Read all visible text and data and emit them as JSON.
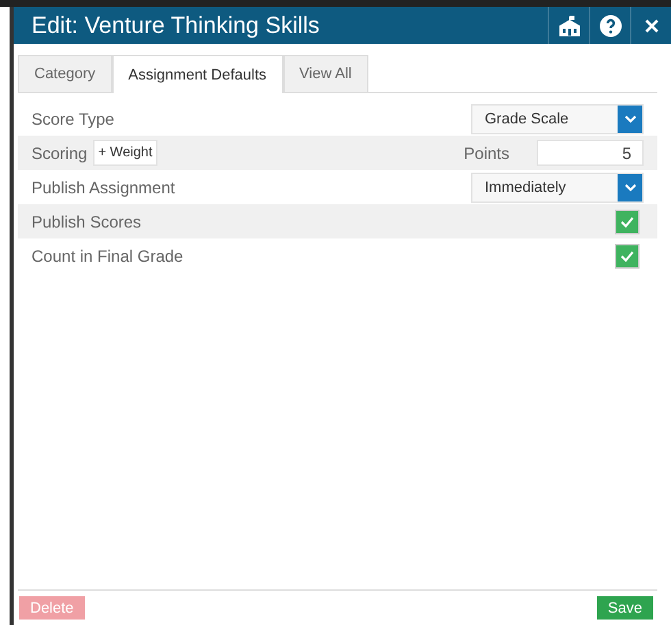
{
  "window": {
    "title": "Edit: Venture Thinking Skills"
  },
  "tabs": [
    {
      "label": "Category",
      "selected": false
    },
    {
      "label": "Assignment Defaults",
      "selected": true
    },
    {
      "label": "View All",
      "selected": false
    }
  ],
  "rows": [
    {
      "kind": "select",
      "label": "Score Type",
      "value": "Grade Scale"
    },
    {
      "kind": "scoring",
      "label": "Scoring",
      "button": "+ Weight",
      "field_label": "Points",
      "value": "5"
    },
    {
      "kind": "select",
      "label": "Publish Assignment",
      "value": "Immediately"
    },
    {
      "kind": "checkbox",
      "label": "Publish Scores",
      "checked": true
    },
    {
      "kind": "checkbox",
      "label": "Count in Final Grade",
      "checked": true
    }
  ],
  "footer": {
    "delete": {
      "label": "Delete",
      "disabled": true
    },
    "save": {
      "label": "Save"
    }
  }
}
